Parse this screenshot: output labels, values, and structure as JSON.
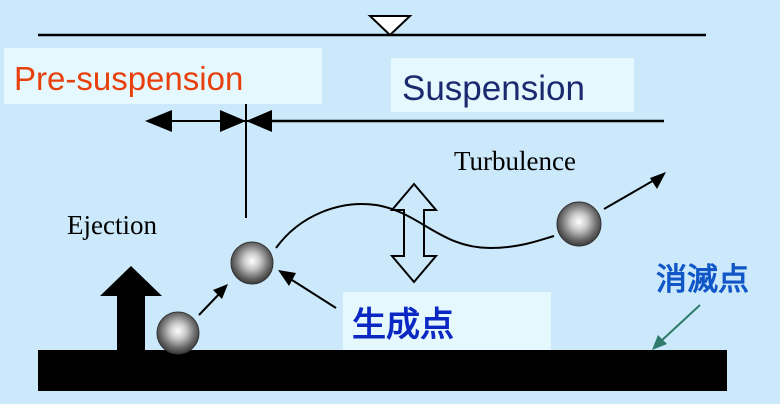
{
  "labels": {
    "pre_suspension": "Pre-suspension",
    "suspension": "Suspension",
    "turbulence": "Turbulence",
    "ejection": "Ejection",
    "generation_point": "生成点",
    "extinction_point": "消滅点"
  },
  "colors": {
    "background": "#cbe9fb",
    "label_box": "#e5f8fd",
    "pre_suspension_text": "#e8400c",
    "suspension_text": "#1a2a6e",
    "generation_text": "#0b27c4",
    "extinction_text": "#1157c8",
    "extinction_arrow": "#2f7a6a",
    "ink": "#000000"
  }
}
